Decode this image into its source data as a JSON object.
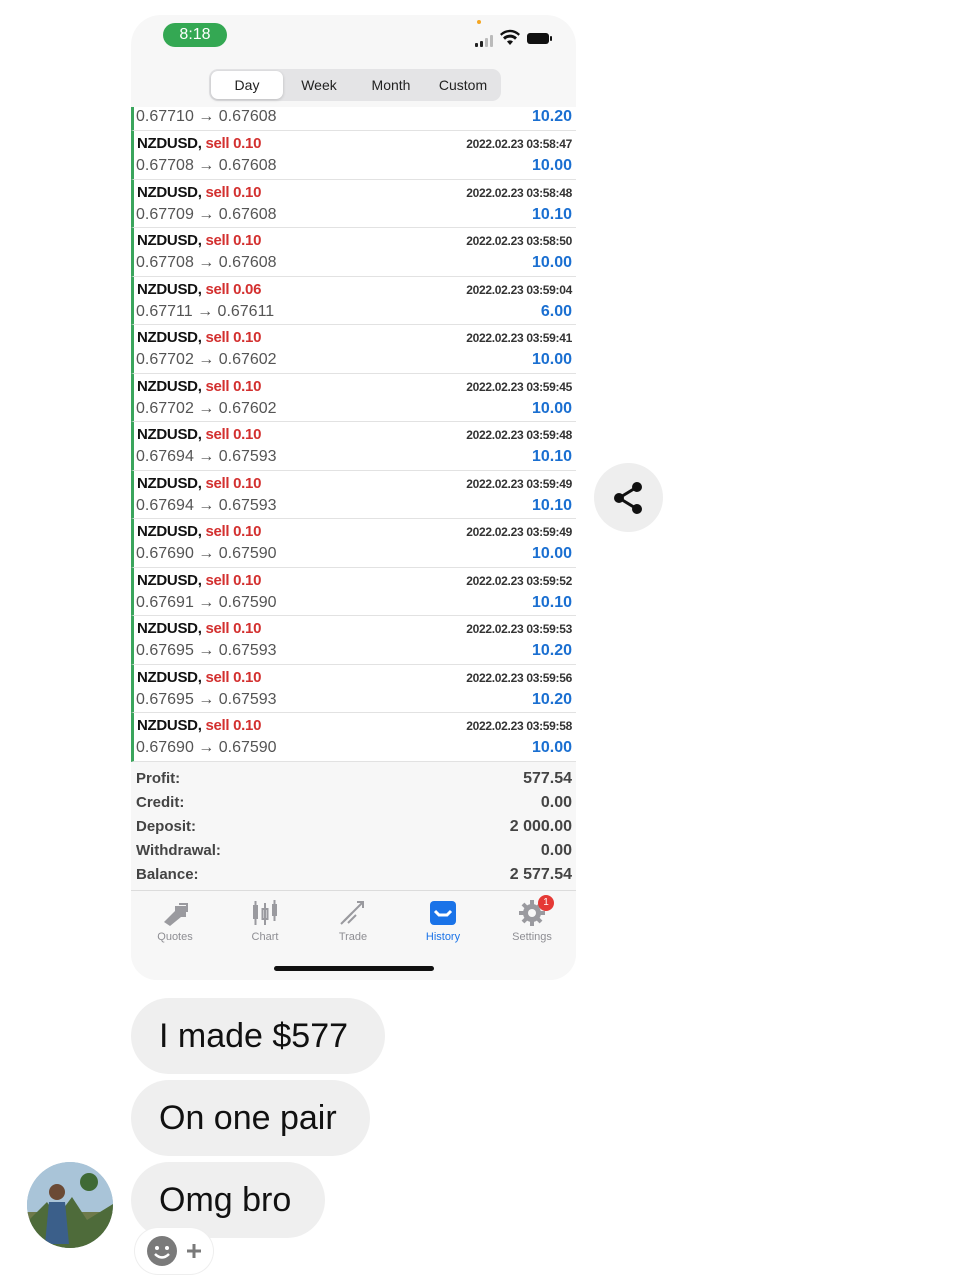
{
  "status_bar": {
    "time": "8:18"
  },
  "period_tabs": [
    "Day",
    "Week",
    "Month",
    "Custom"
  ],
  "active_period": "Day",
  "trades_top_partial": {
    "prices": "0.67710 → 0.67608",
    "profit": "10.20"
  },
  "trades": [
    {
      "symbol": "NZDUSD,",
      "side": "sell 0.10",
      "time": "2022.02.23 03:58:47",
      "prices": "0.67708 → 0.67608",
      "profit": "10.00"
    },
    {
      "symbol": "NZDUSD,",
      "side": "sell 0.10",
      "time": "2022.02.23 03:58:48",
      "prices": "0.67709 → 0.67608",
      "profit": "10.10"
    },
    {
      "symbol": "NZDUSD,",
      "side": "sell 0.10",
      "time": "2022.02.23 03:58:50",
      "prices": "0.67708 → 0.67608",
      "profit": "10.00"
    },
    {
      "symbol": "NZDUSD,",
      "side": "sell 0.06",
      "time": "2022.02.23 03:59:04",
      "prices": "0.67711 → 0.67611",
      "profit": "6.00"
    },
    {
      "symbol": "NZDUSD,",
      "side": "sell 0.10",
      "time": "2022.02.23 03:59:41",
      "prices": "0.67702 → 0.67602",
      "profit": "10.00"
    },
    {
      "symbol": "NZDUSD,",
      "side": "sell 0.10",
      "time": "2022.02.23 03:59:45",
      "prices": "0.67702 → 0.67602",
      "profit": "10.00"
    },
    {
      "symbol": "NZDUSD,",
      "side": "sell 0.10",
      "time": "2022.02.23 03:59:48",
      "prices": "0.67694 → 0.67593",
      "profit": "10.10"
    },
    {
      "symbol": "NZDUSD,",
      "side": "sell 0.10",
      "time": "2022.02.23 03:59:49",
      "prices": "0.67694 → 0.67593",
      "profit": "10.10"
    },
    {
      "symbol": "NZDUSD,",
      "side": "sell 0.10",
      "time": "2022.02.23 03:59:49",
      "prices": "0.67690 → 0.67590",
      "profit": "10.00"
    },
    {
      "symbol": "NZDUSD,",
      "side": "sell 0.10",
      "time": "2022.02.23 03:59:52",
      "prices": "0.67691 → 0.67590",
      "profit": "10.10"
    },
    {
      "symbol": "NZDUSD,",
      "side": "sell 0.10",
      "time": "2022.02.23 03:59:53",
      "prices": "0.67695 → 0.67593",
      "profit": "10.20"
    },
    {
      "symbol": "NZDUSD,",
      "side": "sell 0.10",
      "time": "2022.02.23 03:59:56",
      "prices": "0.67695 → 0.67593",
      "profit": "10.20"
    },
    {
      "symbol": "NZDUSD,",
      "side": "sell 0.10",
      "time": "2022.02.23 03:59:58",
      "prices": "0.67690 → 0.67590",
      "profit": "10.00"
    }
  ],
  "summary": [
    {
      "label": "Profit:",
      "value": "577.54"
    },
    {
      "label": "Credit:",
      "value": "0.00"
    },
    {
      "label": "Deposit:",
      "value": "2 000.00"
    },
    {
      "label": "Withdrawal:",
      "value": "0.00"
    },
    {
      "label": "Balance:",
      "value": "2 577.54"
    }
  ],
  "tabbar": [
    {
      "label": "Quotes",
      "icon": "quotes-icon"
    },
    {
      "label": "Chart",
      "icon": "chart-icon"
    },
    {
      "label": "Trade",
      "icon": "trade-icon"
    },
    {
      "label": "History",
      "icon": "history-icon",
      "active": true
    },
    {
      "label": "Settings",
      "icon": "settings-icon",
      "badge": "1"
    }
  ],
  "messages": [
    "I made $577",
    "On one pair",
    "Omg bro"
  ],
  "colors": {
    "sell": "#d3302f",
    "profit": "#1a6fd1",
    "active_tab": "#1a73e8",
    "badge": "#e53935",
    "time_pill": "#34a853"
  }
}
